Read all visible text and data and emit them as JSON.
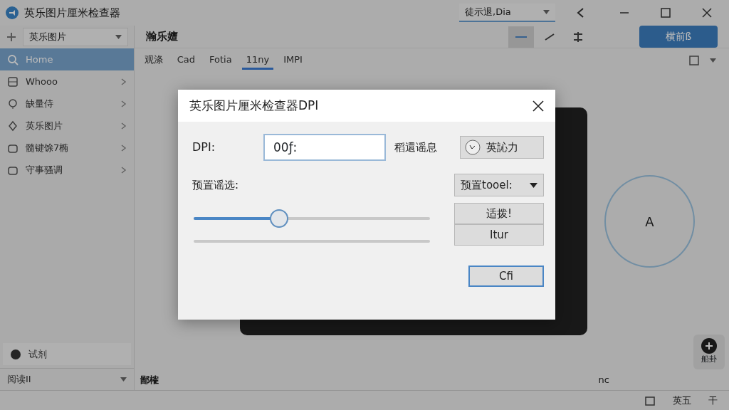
{
  "window": {
    "title": "英乐图片厘米检查器",
    "search": {
      "value": "徒示退,Dia"
    }
  },
  "sidebar": {
    "dropdown": "英乐图片",
    "items": [
      {
        "label": "Home",
        "selected": true
      },
      {
        "label": "Whooo",
        "selected": false
      },
      {
        "label": "缺量侍",
        "selected": false
      },
      {
        "label": "英乐图片",
        "selected": false
      },
      {
        "label": "髓键馀7椭",
        "selected": false
      },
      {
        "label": "守事骚调",
        "selected": false
      }
    ],
    "footer_item": "试剂",
    "footer_dropdown": "阅读II"
  },
  "main": {
    "heading": "瀚乐嬗",
    "primary_button": "横前ß",
    "tabs": [
      {
        "label": "观涤",
        "selected": false
      },
      {
        "label": "Cad",
        "selected": false
      },
      {
        "label": "Fotia",
        "selected": false
      },
      {
        "label": "11ny",
        "selected": true
      },
      {
        "label": "IMPI",
        "selected": false
      }
    ],
    "dial_label": "A",
    "fab_label": "船卦",
    "bottom_label": "鄙榷",
    "corner_text": "nc"
  },
  "status_bar": {
    "items": [
      "英五",
      "干"
    ]
  },
  "dialog": {
    "title": "英乐图片厘米检查器DPI",
    "dpi_label": "DPI:",
    "dpi_value": "00ƒ:",
    "info_label": "稻還谣息",
    "apply_button": "英訫力",
    "preset_label": "预置谣选:",
    "preset_dropdown": "预置tooel:",
    "slider": {
      "level": 0.36
    },
    "button_group": [
      "适拨!",
      "Itur"
    ],
    "ok_button": "Cfi"
  }
}
